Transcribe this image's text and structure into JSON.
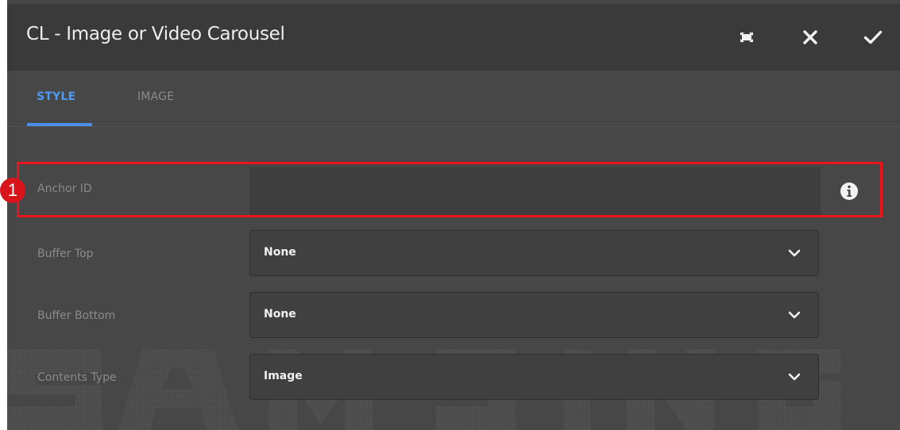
{
  "dialog": {
    "title": "CL - Image or Video Carousel",
    "header_buttons": [
      {
        "icon": "fullscreen-icon"
      },
      {
        "icon": "close-icon"
      },
      {
        "icon": "checkmark-icon"
      }
    ]
  },
  "tabs": [
    {
      "label": "STYLE",
      "active": true
    },
    {
      "label": "IMAGE",
      "active": false
    }
  ],
  "fields": {
    "anchor_id": {
      "label": "Anchor ID",
      "value": "",
      "icon": "info-icon"
    },
    "buffer_top": {
      "label": "Buffer Top",
      "value": "None"
    },
    "buffer_bottom": {
      "label": "Buffer Bottom",
      "value": "None"
    },
    "contents_type": {
      "label": "Contents Type",
      "value": "Image"
    }
  },
  "annotation": {
    "marker_number": "1",
    "color": "#e8151b"
  },
  "colors": {
    "accent": "#4e9bf2",
    "dialog_bg": "#474747",
    "header_bg": "#3a3a3a"
  }
}
